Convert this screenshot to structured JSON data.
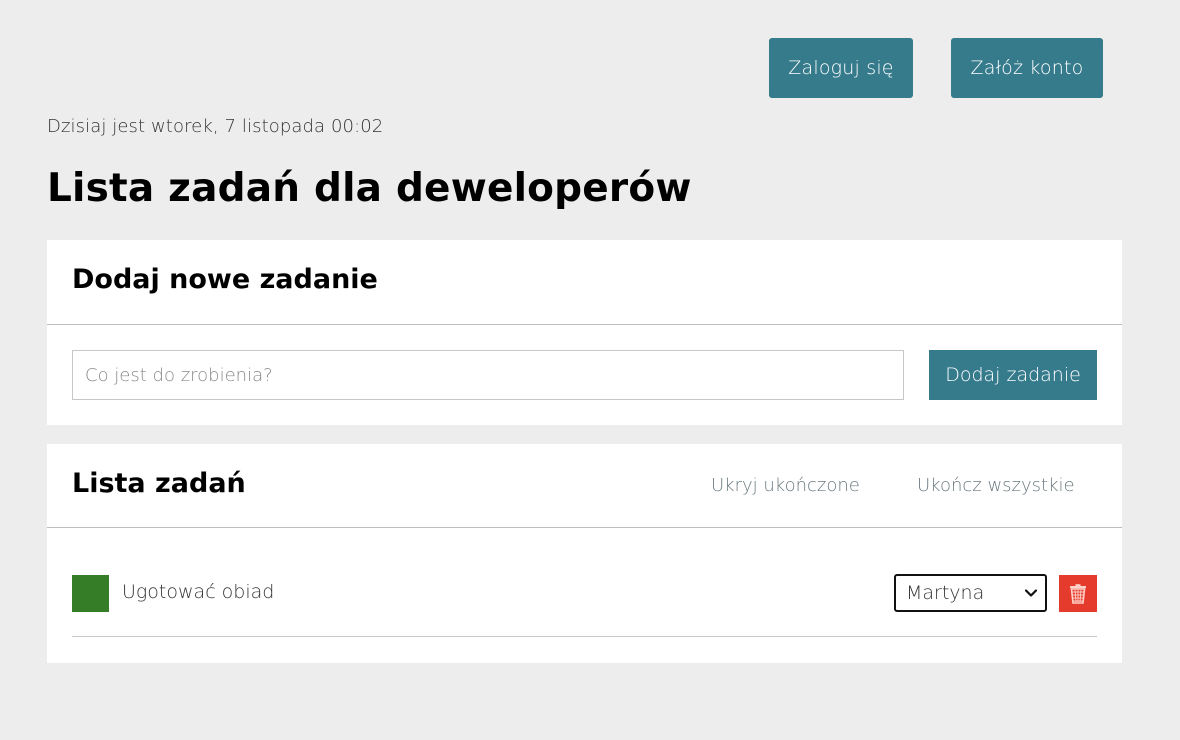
{
  "auth": {
    "login_label": "Zaloguj się",
    "register_label": "Załóż konto"
  },
  "date_text": "Dzisiaj jest wtorek, 7 listopada 00:02",
  "page_title": "Lista zadań dla deweloperów",
  "add_section": {
    "title": "Dodaj nowe zadanie",
    "input_placeholder": "Co jest do zrobienia?",
    "input_value": "",
    "add_button_label": "Dodaj zadanie"
  },
  "list_section": {
    "title": "Lista zadań",
    "hide_completed_label": "Ukryj ukończone",
    "complete_all_label": "Ukończ wszystkie",
    "tasks": [
      {
        "label": "Ugotować obiad",
        "assignee": "Martyna",
        "completed": true
      }
    ]
  },
  "icons": {
    "checkbox": "checkbox-icon",
    "chevron": "chevron-down-icon",
    "delete": "trash-icon"
  },
  "colors": {
    "primary": "#367b8c",
    "background": "#ededed",
    "done": "#357e27",
    "danger": "#e53b2c",
    "link": "#6a7a80"
  }
}
